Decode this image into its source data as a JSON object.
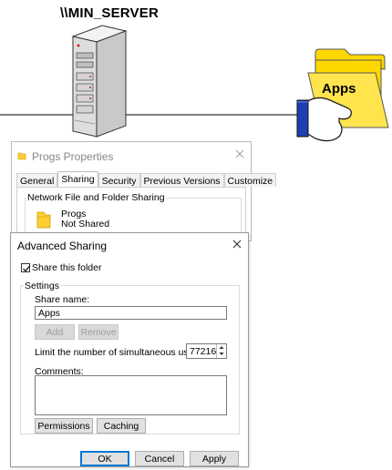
{
  "diagram": {
    "server_name": "\\\\MIN_SERVER",
    "share_label": "Apps"
  },
  "properties_dialog": {
    "title": "Progs Properties",
    "tabs": [
      "General",
      "Sharing",
      "Security",
      "Previous Versions",
      "Customize"
    ],
    "active_tab": "Sharing",
    "group_label": "Network File and Folder Sharing",
    "folder_name": "Progs",
    "share_status": "Not Shared"
  },
  "advanced_sharing": {
    "title": "Advanced Sharing",
    "share_checkbox_label": "Share this folder",
    "share_checked": true,
    "settings_label": "Settings",
    "share_name_label": "Share name:",
    "share_name_value": "Apps",
    "add_label": "Add",
    "remove_label": "Remove",
    "limit_label": "Limit the number of simultaneous users to:",
    "limit_value": "77216",
    "comments_label": "Comments:",
    "comments_value": "",
    "permissions_label": "Permissions",
    "caching_label": "Caching",
    "ok_label": "OK",
    "cancel_label": "Cancel",
    "apply_label": "Apply"
  },
  "colors": {
    "folder_yellow": "#ffd700",
    "folder_outline": "#b8a000",
    "accent_blue": "#0078d7"
  }
}
